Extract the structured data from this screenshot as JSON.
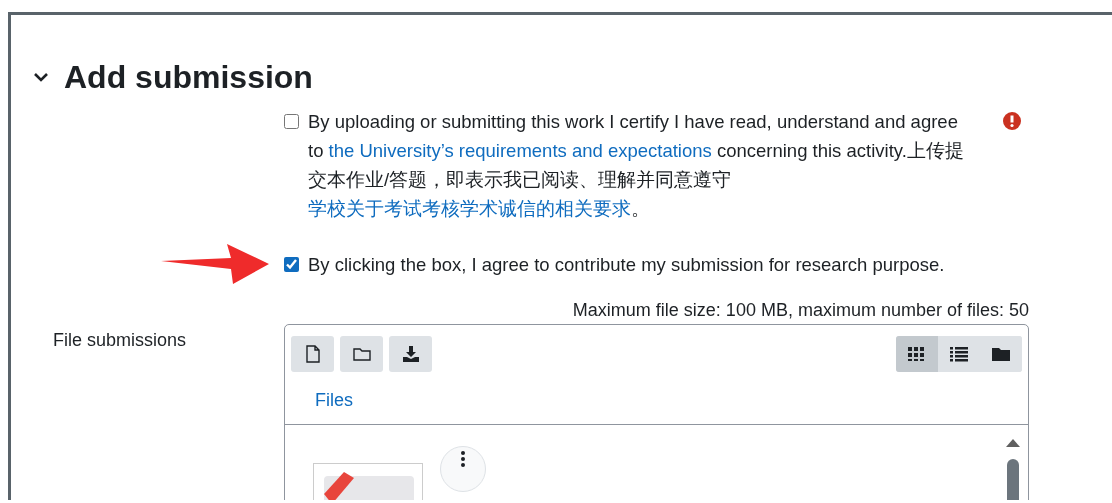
{
  "section": {
    "title": "Add submission",
    "expanded": true
  },
  "agreements": [
    {
      "checked": false,
      "required": true,
      "segments": [
        {
          "kind": "text",
          "text": "By uploading or submitting this work I certify I have read, understand and agree to "
        },
        {
          "kind": "link",
          "text": "the University’s requirements and expectations"
        },
        {
          "kind": "text",
          "text": " concerning this activity.上传提交本作业/答题，即表示我已阅读、理解并同意遵守"
        },
        {
          "kind": "link",
          "text": "学校关于考试考核学术诚信的相关要求"
        },
        {
          "kind": "text",
          "text": "。"
        }
      ]
    },
    {
      "checked": true,
      "required": false,
      "pointer": true,
      "segments": [
        {
          "kind": "text",
          "text": "By clicking the box, I agree to contribute my submission for research purpose."
        }
      ]
    }
  ],
  "file_submissions": {
    "label": "File submissions",
    "limits": "Maximum file size: 100 MB, maximum number of files: 50",
    "views": [
      {
        "kind": "grid",
        "selected": true
      },
      {
        "kind": "list",
        "selected": false
      },
      {
        "kind": "tree",
        "selected": false
      }
    ],
    "breadcrumb": "Files"
  }
}
